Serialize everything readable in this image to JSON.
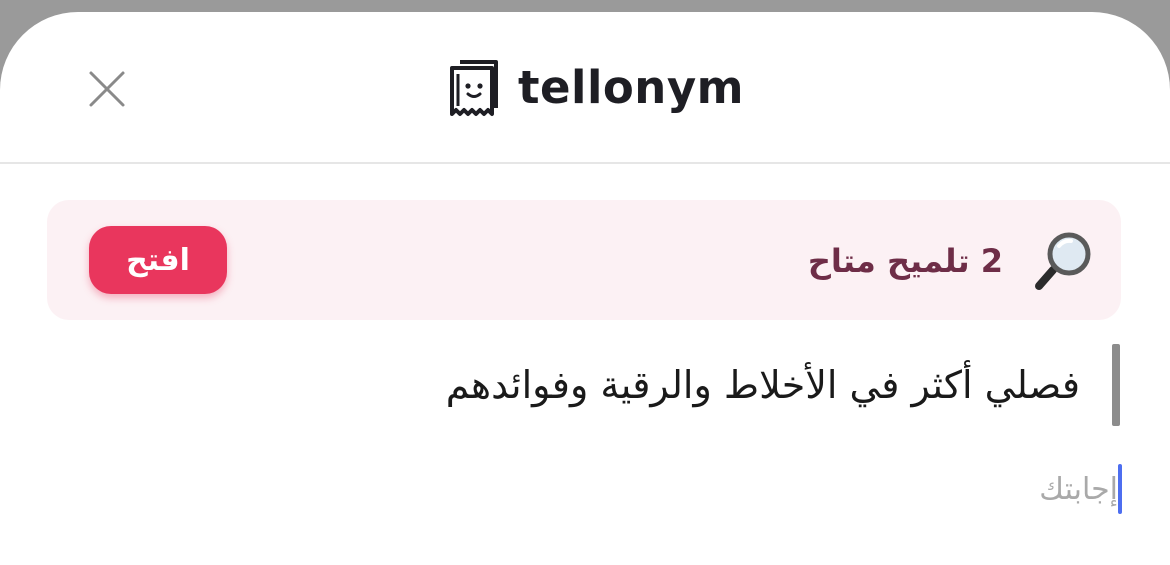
{
  "header": {
    "close_icon": "close-icon",
    "logo_icon": "tellonym-ghost-icon",
    "logo_text": "tellonym"
  },
  "hint_banner": {
    "icon": "magnifier-icon",
    "text": "2 تلميح متاح",
    "open_label": "افتح"
  },
  "question": {
    "text": "فصلي أكثر في الأخلاط والرقية وفوائدهم"
  },
  "answer": {
    "placeholder": "إجابتك",
    "value": ""
  },
  "colors": {
    "accent": "#e9365d",
    "hint_background": "#fcf1f4",
    "hint_text": "#6e2d47",
    "caret": "#4d6ef0"
  }
}
